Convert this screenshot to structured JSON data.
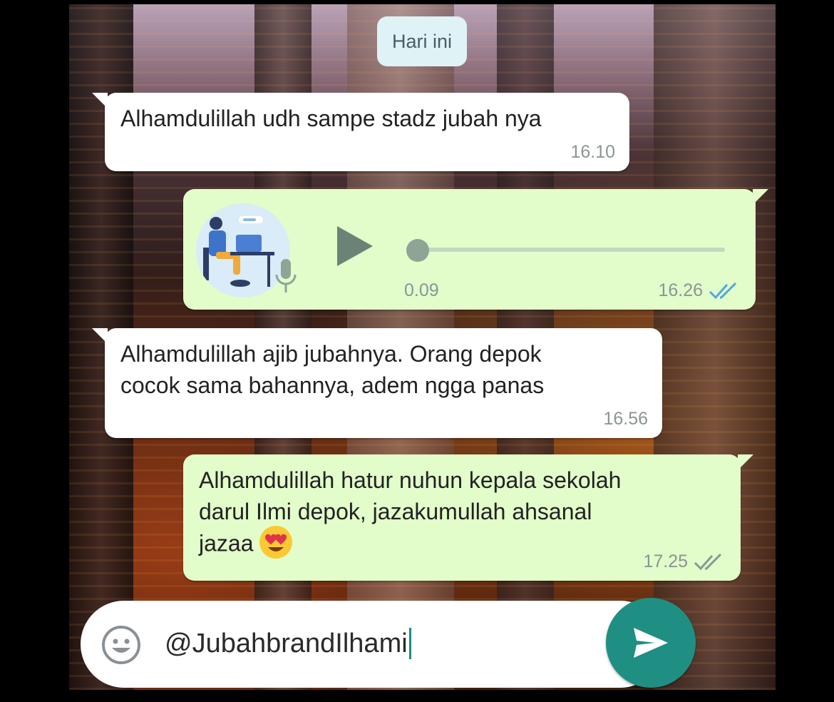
{
  "date_chip": "Hari ini",
  "messages": [
    {
      "type": "text",
      "direction": "incoming",
      "text": "Alhamdulillah udh sampe stadz jubah nya",
      "time": "16.10"
    },
    {
      "type": "voice",
      "direction": "outgoing",
      "duration": "0.09",
      "time": "16.26",
      "status": "read",
      "status_color": "#4fa9e0",
      "progress": 0.0
    },
    {
      "type": "text",
      "direction": "incoming",
      "text": "Alhamdulillah ajib jubahnya. Orang depok\ncocok sama bahannya, adem ngga panas",
      "time": "16.56"
    },
    {
      "type": "text",
      "direction": "outgoing",
      "text": "Alhamdulillah hatur nuhun kepala sekolah\ndarul Ilmi depok, jazakumullah ahsanal\njazaa",
      "emoji": "heart-eyes-emoji",
      "time": "17.25",
      "status": "delivered",
      "status_color": "#8b9595"
    }
  ],
  "composer": {
    "value": "@JubahbrandIlhami",
    "emoji_icon": "smile-icon",
    "attach_icon": "paperclip-icon",
    "send_icon": "send-icon"
  },
  "colors": {
    "outgoing_bubble": "#e2fdca",
    "incoming_bubble": "#ffffff",
    "date_chip": "#dff2f6",
    "send_button": "#1f8f83"
  }
}
